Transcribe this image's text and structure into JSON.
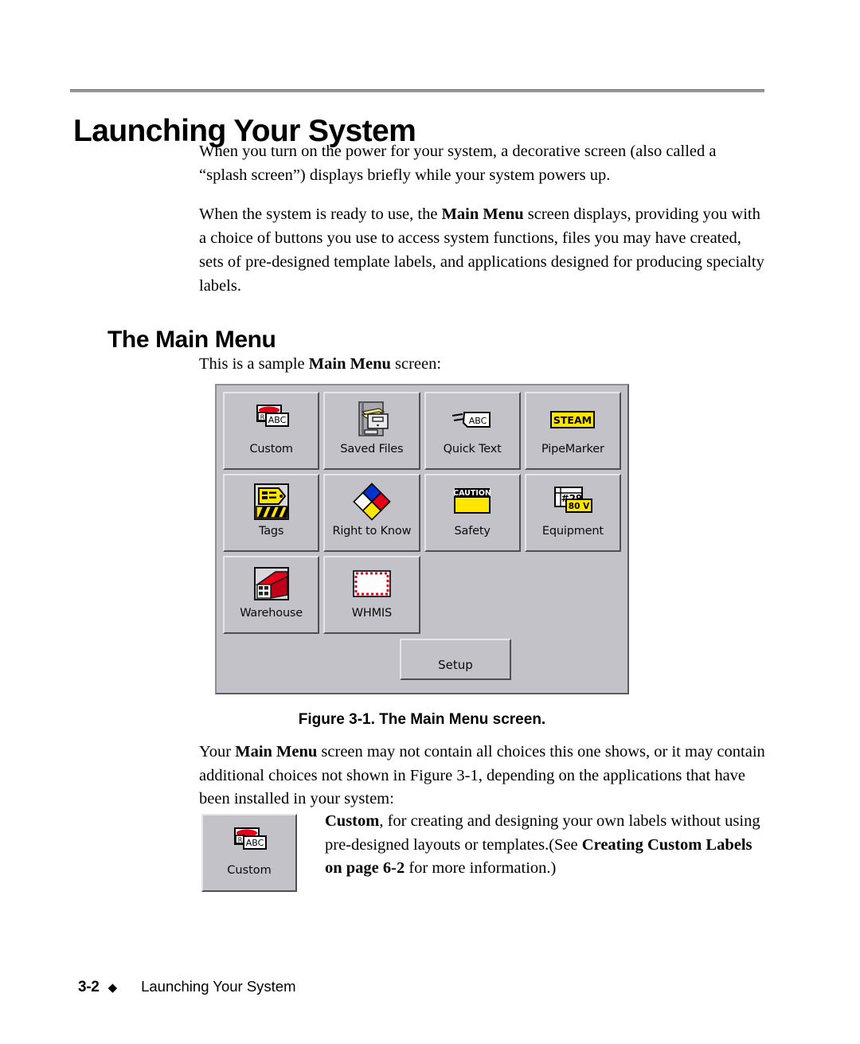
{
  "document": {
    "chapter_title": "Launching Your System",
    "section_heading": "The Main Menu",
    "paragraphs": {
      "intro_1": "When you turn on the power for your system, a decorative screen (also called a “splash screen”) displays briefly while your system powers up.",
      "intro_2_a": "When the system is ready to use, the ",
      "intro_2_b": "Main Menu",
      "intro_2_c": " screen displays, providing you with a choice of buttons you use to access system functions, files you may have created, sets of pre-designed template labels, and applications designed for producing specialty labels.",
      "sample_a": "This is a sample ",
      "sample_b": "Main Menu",
      "sample_c": " screen:",
      "after_figure_a": "Your ",
      "after_figure_b": "Main Menu",
      "after_figure_c": " screen may not contain all choices this one shows, or it may contain additional choices not shown in Figure 3-1, depending on the applications that have been installed in your system:"
    },
    "figure_caption": "Figure 3-1. The Main Menu screen."
  },
  "main_menu": {
    "buttons": [
      {
        "label": "Custom",
        "icon": "custom-label-icon"
      },
      {
        "label": "Saved Files",
        "icon": "file-cabinet-icon"
      },
      {
        "label": "Quick Text",
        "icon": "quick-text-icon"
      },
      {
        "label": "PipeMarker",
        "icon": "pipemarker-steam-icon"
      },
      {
        "label": "Tags",
        "icon": "tag-hazard-icon"
      },
      {
        "label": "Right to Know",
        "icon": "nfpa-diamond-icon"
      },
      {
        "label": "Safety",
        "icon": "caution-sign-icon"
      },
      {
        "label": "Equipment",
        "icon": "equipment-voltage-icon"
      },
      {
        "label": "Warehouse",
        "icon": "warehouse-building-icon"
      },
      {
        "label": "WHMIS",
        "icon": "whmis-border-icon"
      }
    ],
    "setup_label": "Setup",
    "icon_text": {
      "custom_r": "R",
      "custom_abc": "ABC",
      "quick_text_abc": "ABC",
      "pipemarker_steam": "STEAM",
      "safety_caution": "CAUTION",
      "equipment_id": "#29",
      "equipment_volts": "80 V"
    },
    "colors": {
      "panel_face": "#c3c2c8",
      "yellow": "#ffe500",
      "red": "#e4001b",
      "blue": "#0033cc",
      "white": "#ffffff"
    }
  },
  "callout": {
    "thumb_label": "Custom",
    "text_a": "Custom",
    "text_b": ", for creating and designing your own labels without using pre-designed layouts or templates.(See ",
    "text_c": "Creating Custom Labels on page 6-2",
    "text_d": " for more information.)"
  },
  "footer": {
    "page_number": "3-2",
    "diamond": "◆",
    "title": "Launching Your System"
  }
}
